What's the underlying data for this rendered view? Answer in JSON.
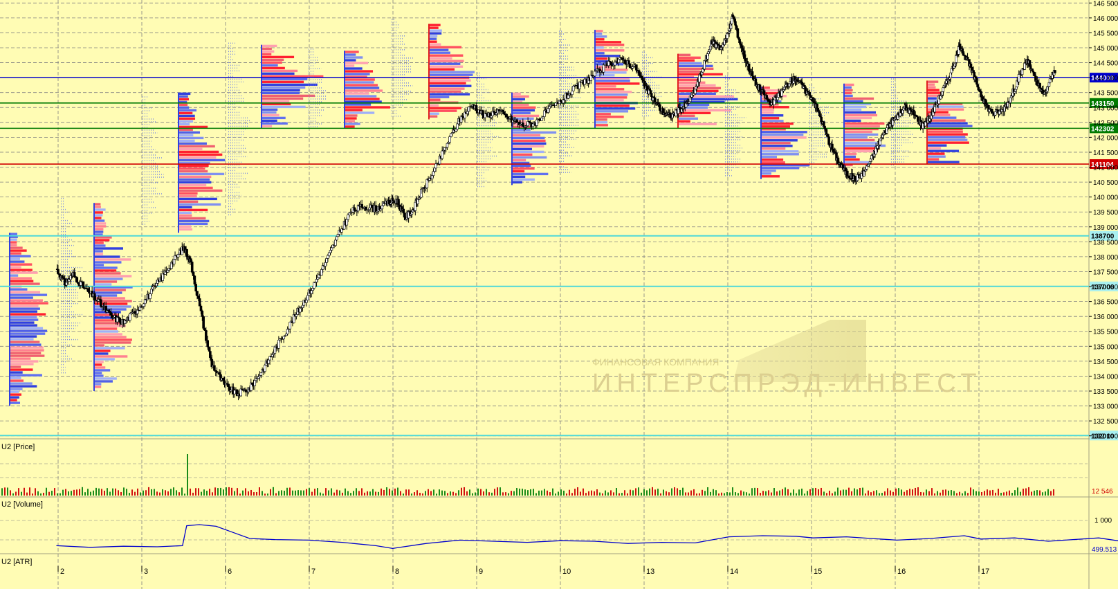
{
  "panels": {
    "price": {
      "label": "U2 [Price]"
    },
    "volume": {
      "label": "U2 [Volume]",
      "last_value": "12 546"
    },
    "atr": {
      "label": "U2 [ATR]",
      "top_value": "1 000",
      "last_value": "499.513"
    }
  },
  "watermark": {
    "line1": "ФИНАНСОВАЯ КОМПАНИЯ",
    "line2": "ИНТЕРСПРЭД-ИНВЕСТ"
  },
  "colors": {
    "background": "#FFFCB4",
    "grid": "#808080",
    "candle": "#000000",
    "profile_red": "#FF3040",
    "profile_blue": "#4050F0",
    "volume_up": "#1A8A1A",
    "volume_down": "#D01010",
    "atr_line": "#0000CC"
  },
  "chart_data": {
    "type": "line",
    "instrument": "U2",
    "price_axis": {
      "ticks": [
        "146 500",
        "146 000",
        "145 500",
        "145 000",
        "144 500",
        "144 000",
        "143 500",
        "143 000",
        "142 500",
        "142 000",
        "141 500",
        "141 000",
        "140 500",
        "140 000",
        "139 500",
        "139 000",
        "138 500",
        "138 000",
        "137 500",
        "137 000",
        "136 500",
        "136 000",
        "135 500",
        "135 000",
        "134 500",
        "134 000",
        "133 500",
        "133 000",
        "132 500",
        "132 000"
      ],
      "ylim": [
        131900,
        146600
      ]
    },
    "level_lines": [
      {
        "value": 144000,
        "label": "144000",
        "color": "#0000CC"
      },
      {
        "value": 143150,
        "label": "143150",
        "color": "#007A00"
      },
      {
        "value": 142302,
        "label": "142302",
        "color": "#007A00"
      },
      {
        "value": 141104,
        "label": "141104",
        "color": "#D00000"
      },
      {
        "value": 138700,
        "label": "138700",
        "color": "#50D8D8"
      },
      {
        "value": 137006,
        "label": "137006",
        "color": "#50D8D8"
      },
      {
        "value": 132010,
        "label": "132010",
        "color": "#50D8D8"
      }
    ],
    "day_labels": [
      "2",
      "3",
      "6",
      "7",
      "8",
      "9",
      "10",
      "13",
      "14",
      "15",
      "16",
      "17"
    ],
    "price_path": [
      {
        "day": 1.0,
        "price": 137600
      },
      {
        "day": 1.1,
        "price": 137100
      },
      {
        "day": 1.2,
        "price": 137400
      },
      {
        "day": 1.35,
        "price": 136900
      },
      {
        "day": 1.5,
        "price": 136500
      },
      {
        "day": 1.65,
        "price": 136000
      },
      {
        "day": 1.8,
        "price": 135800
      },
      {
        "day": 1.95,
        "price": 136200
      },
      {
        "day": 2.1,
        "price": 136700
      },
      {
        "day": 2.25,
        "price": 137300
      },
      {
        "day": 2.4,
        "price": 137900
      },
      {
        "day": 2.52,
        "price": 138300
      },
      {
        "day": 2.6,
        "price": 137800
      },
      {
        "day": 2.75,
        "price": 135700
      },
      {
        "day": 2.85,
        "price": 134400
      },
      {
        "day": 3.0,
        "price": 133700
      },
      {
        "day": 3.15,
        "price": 133400
      },
      {
        "day": 3.3,
        "price": 133600
      },
      {
        "day": 3.45,
        "price": 134200
      },
      {
        "day": 3.6,
        "price": 134900
      },
      {
        "day": 3.75,
        "price": 135600
      },
      {
        "day": 3.9,
        "price": 136300
      },
      {
        "day": 4.05,
        "price": 137000
      },
      {
        "day": 4.2,
        "price": 137800
      },
      {
        "day": 4.35,
        "price": 138700
      },
      {
        "day": 4.5,
        "price": 139500
      },
      {
        "day": 4.65,
        "price": 139700
      },
      {
        "day": 4.8,
        "price": 139600
      },
      {
        "day": 4.95,
        "price": 139800
      },
      {
        "day": 5.05,
        "price": 139900
      },
      {
        "day": 5.15,
        "price": 139300
      },
      {
        "day": 5.25,
        "price": 139600
      },
      {
        "day": 5.35,
        "price": 140200
      },
      {
        "day": 5.5,
        "price": 140900
      },
      {
        "day": 5.65,
        "price": 141800
      },
      {
        "day": 5.8,
        "price": 142600
      },
      {
        "day": 5.95,
        "price": 143100
      },
      {
        "day": 6.1,
        "price": 142700
      },
      {
        "day": 6.25,
        "price": 142900
      },
      {
        "day": 6.4,
        "price": 142600
      },
      {
        "day": 6.55,
        "price": 142400
      },
      {
        "day": 6.7,
        "price": 142500
      },
      {
        "day": 6.85,
        "price": 142900
      },
      {
        "day": 7.0,
        "price": 143200
      },
      {
        "day": 7.15,
        "price": 143600
      },
      {
        "day": 7.3,
        "price": 143900
      },
      {
        "day": 7.45,
        "price": 144200
      },
      {
        "day": 7.6,
        "price": 144500
      },
      {
        "day": 7.75,
        "price": 144600
      },
      {
        "day": 7.9,
        "price": 144300
      },
      {
        "day": 8.0,
        "price": 143700
      },
      {
        "day": 8.1,
        "price": 143300
      },
      {
        "day": 8.2,
        "price": 142900
      },
      {
        "day": 8.3,
        "price": 142700
      },
      {
        "day": 8.4,
        "price": 142900
      },
      {
        "day": 8.5,
        "price": 143100
      },
      {
        "day": 8.6,
        "price": 143600
      },
      {
        "day": 8.7,
        "price": 144400
      },
      {
        "day": 8.8,
        "price": 145200
      },
      {
        "day": 8.9,
        "price": 145000
      },
      {
        "day": 9.0,
        "price": 145500
      },
      {
        "day": 9.05,
        "price": 146100
      },
      {
        "day": 9.12,
        "price": 145300
      },
      {
        "day": 9.2,
        "price": 144600
      },
      {
        "day": 9.3,
        "price": 143900
      },
      {
        "day": 9.4,
        "price": 143500
      },
      {
        "day": 9.5,
        "price": 143100
      },
      {
        "day": 9.6,
        "price": 143400
      },
      {
        "day": 9.7,
        "price": 143800
      },
      {
        "day": 9.8,
        "price": 144000
      },
      {
        "day": 9.9,
        "price": 143600
      },
      {
        "day": 10.0,
        "price": 143300
      },
      {
        "day": 10.1,
        "price": 142600
      },
      {
        "day": 10.2,
        "price": 141800
      },
      {
        "day": 10.3,
        "price": 141200
      },
      {
        "day": 10.4,
        "price": 140800
      },
      {
        "day": 10.5,
        "price": 140600
      },
      {
        "day": 10.6,
        "price": 140800
      },
      {
        "day": 10.7,
        "price": 141300
      },
      {
        "day": 10.8,
        "price": 141900
      },
      {
        "day": 10.9,
        "price": 142400
      },
      {
        "day": 11.0,
        "price": 142700
      },
      {
        "day": 11.1,
        "price": 143000
      },
      {
        "day": 11.2,
        "price": 142800
      },
      {
        "day": 11.3,
        "price": 142400
      },
      {
        "day": 11.4,
        "price": 142700
      },
      {
        "day": 11.5,
        "price": 143300
      },
      {
        "day": 11.6,
        "price": 143900
      },
      {
        "day": 11.7,
        "price": 144600
      },
      {
        "day": 11.75,
        "price": 145100
      },
      {
        "day": 11.85,
        "price": 144500
      },
      {
        "day": 11.95,
        "price": 143800
      },
      {
        "day": 12.05,
        "price": 143100
      },
      {
        "day": 12.15,
        "price": 142800
      },
      {
        "day": 12.25,
        "price": 142900
      },
      {
        "day": 12.35,
        "price": 143300
      },
      {
        "day": 12.45,
        "price": 144000
      },
      {
        "day": 12.55,
        "price": 144600
      },
      {
        "day": 12.65,
        "price": 143900
      },
      {
        "day": 12.75,
        "price": 143400
      },
      {
        "day": 12.85,
        "price": 144100
      },
      {
        "day": 12.95,
        "price": 144600
      },
      {
        "day": 13.05,
        "price": 144200
      },
      {
        "day": 13.15,
        "price": 143800
      },
      {
        "day": 13.25,
        "price": 143200
      },
      {
        "day": 13.35,
        "price": 142600
      },
      {
        "day": 13.45,
        "price": 141900
      },
      {
        "day": 13.55,
        "price": 141300
      },
      {
        "day": 13.65,
        "price": 141000
      },
      {
        "day": 13.75,
        "price": 141200
      },
      {
        "day": 13.85,
        "price": 141600
      },
      {
        "day": 13.95,
        "price": 142200
      },
      {
        "day": 14.05,
        "price": 142800
      },
      {
        "day": 14.15,
        "price": 143200
      },
      {
        "day": 14.25,
        "price": 142900
      },
      {
        "day": 14.35,
        "price": 142600
      },
      {
        "day": 14.45,
        "price": 142700
      },
      {
        "day": 14.55,
        "price": 142900
      },
      {
        "day": 14.65,
        "price": 142600
      },
      {
        "day": 14.75,
        "price": 142200
      },
      {
        "day": 14.85,
        "price": 142500
      },
      {
        "day": 14.95,
        "price": 143000
      },
      {
        "day": 15.05,
        "price": 143500
      },
      {
        "day": 15.15,
        "price": 143900
      },
      {
        "day": 15.25,
        "price": 143600
      },
      {
        "day": 15.35,
        "price": 143200
      },
      {
        "day": 15.45,
        "price": 142700
      },
      {
        "day": 15.55,
        "price": 142300
      },
      {
        "day": 15.65,
        "price": 141900
      },
      {
        "day": 15.75,
        "price": 141300
      },
      {
        "day": 15.85,
        "price": 141000
      },
      {
        "day": 15.95,
        "price": 141300
      },
      {
        "day": 16.05,
        "price": 141700
      },
      {
        "day": 16.12,
        "price": 142000
      },
      {
        "day": 16.2,
        "price": 141800
      }
    ],
    "volume_panel": {
      "type": "bar",
      "spike": {
        "day": 2.55,
        "value": 55000
      },
      "typical_value": 8000,
      "last_value": 12546
    },
    "atr_panel": {
      "type": "line",
      "top_tick": 1000,
      "last_value": 499.513,
      "points": [
        {
          "day": 1.0,
          "value": 520
        },
        {
          "day": 1.4,
          "value": 490
        },
        {
          "day": 1.8,
          "value": 510
        },
        {
          "day": 2.2,
          "value": 500
        },
        {
          "day": 2.5,
          "value": 520
        },
        {
          "day": 2.55,
          "value": 880
        },
        {
          "day": 2.7,
          "value": 900
        },
        {
          "day": 2.9,
          "value": 870
        },
        {
          "day": 3.1,
          "value": 760
        },
        {
          "day": 3.3,
          "value": 650
        },
        {
          "day": 3.6,
          "value": 630
        },
        {
          "day": 4.0,
          "value": 620
        },
        {
          "day": 4.4,
          "value": 580
        },
        {
          "day": 4.8,
          "value": 520
        },
        {
          "day": 5.0,
          "value": 470
        },
        {
          "day": 5.4,
          "value": 560
        },
        {
          "day": 5.8,
          "value": 620
        },
        {
          "day": 6.2,
          "value": 600
        },
        {
          "day": 6.6,
          "value": 580
        },
        {
          "day": 7.0,
          "value": 610
        },
        {
          "day": 7.4,
          "value": 600
        },
        {
          "day": 7.8,
          "value": 560
        },
        {
          "day": 8.2,
          "value": 580
        },
        {
          "day": 8.6,
          "value": 570
        },
        {
          "day": 9.0,
          "value": 680
        },
        {
          "day": 9.4,
          "value": 700
        },
        {
          "day": 9.8,
          "value": 690
        },
        {
          "day": 10.0,
          "value": 660
        },
        {
          "day": 10.4,
          "value": 680
        },
        {
          "day": 10.8,
          "value": 640
        },
        {
          "day": 11.0,
          "value": 620
        },
        {
          "day": 11.4,
          "value": 650
        },
        {
          "day": 11.8,
          "value": 700
        },
        {
          "day": 12.0,
          "value": 640
        },
        {
          "day": 12.4,
          "value": 660
        },
        {
          "day": 12.8,
          "value": 600
        },
        {
          "day": 13.0,
          "value": 620
        },
        {
          "day": 13.4,
          "value": 660
        },
        {
          "day": 13.8,
          "value": 570
        },
        {
          "day": 14.2,
          "value": 580
        },
        {
          "day": 14.6,
          "value": 560
        },
        {
          "day": 15.0,
          "value": 590
        },
        {
          "day": 15.4,
          "value": 610
        },
        {
          "day": 15.8,
          "value": 560
        },
        {
          "day": 16.0,
          "value": 520
        },
        {
          "day": 16.2,
          "value": 500
        }
      ]
    }
  }
}
